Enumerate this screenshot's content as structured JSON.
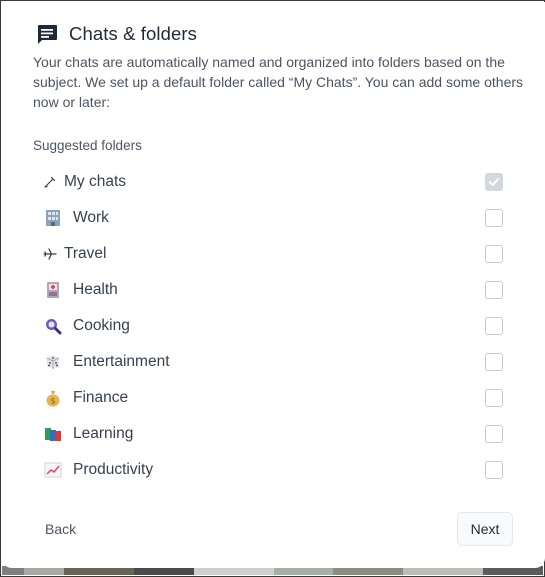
{
  "dialog": {
    "title": "Chats & folders",
    "icon": "chat-bubble-icon",
    "description": "Your chats are automatically named and organized into folders based on the subject. We set up a default folder called “My Chats”. You can add some others now or later:",
    "section_label": "Suggested folders",
    "folders": [
      {
        "label": "My chats",
        "icon": "pencil-icon",
        "checked": true,
        "disabled": true
      },
      {
        "label": "Work",
        "icon": "office-building-icon",
        "checked": false
      },
      {
        "label": "Travel",
        "icon": "airplane-icon",
        "checked": false
      },
      {
        "label": "Health",
        "icon": "medical-kit-icon",
        "checked": false
      },
      {
        "label": "Cooking",
        "icon": "magnifier-icon",
        "checked": false
      },
      {
        "label": "Entertainment",
        "icon": "dice-icon",
        "checked": false
      },
      {
        "label": "Finance",
        "icon": "money-bag-icon",
        "checked": false
      },
      {
        "label": "Learning",
        "icon": "books-icon",
        "checked": false
      },
      {
        "label": "Productivity",
        "icon": "chart-increasing-icon",
        "checked": false
      }
    ],
    "back_label": "Back",
    "next_label": "Next"
  }
}
